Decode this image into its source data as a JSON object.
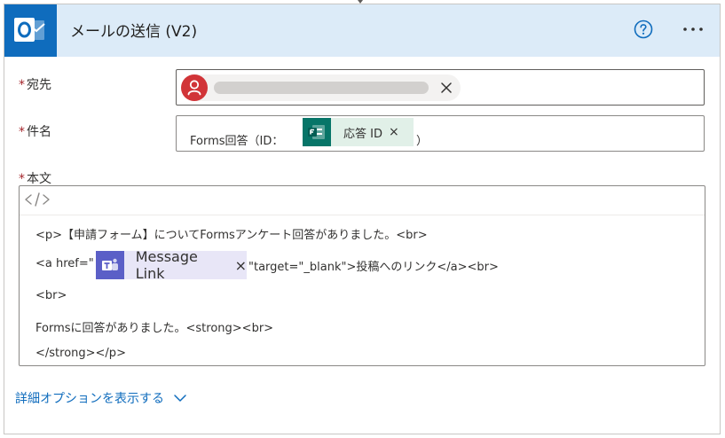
{
  "header": {
    "title": "メールの送信 (V2)",
    "app_icon": "outlook-icon",
    "help_icon": "help-circle-icon",
    "more_icon": "more-dots-icon",
    "background_color": "#dcebf8",
    "accent_color": "#0f6cbd"
  },
  "fields": {
    "to": {
      "required_mark": "*",
      "label": "宛先",
      "avatar_icon": "person-icon",
      "remove_icon": "close-icon"
    },
    "subject": {
      "required_mark": "*",
      "label": "件名",
      "text_before": "Forms回答（ID：",
      "token": {
        "label": "応答 ID",
        "remove": "×",
        "icon": "microsoft-forms-icon",
        "color": "#077568"
      },
      "text_after": "）"
    },
    "body": {
      "required_mark": "*",
      "label": "本文",
      "code_view_icon": "code-view-icon",
      "line1": "<p>【申請フォーム】についてFormsアンケート回答がありました。<br>",
      "line2_before": "<a href=\"",
      "line2_token": {
        "label": "Message Link",
        "remove": "×",
        "icon": "microsoft-teams-icon",
        "color": "#5b5fc7"
      },
      "line2_after": "\"target=\"_blank\">投稿へのリンク</a><br>",
      "line3": "<br>",
      "line4": "Formsに回答がありました。<strong><br>",
      "line5": "</strong></p>"
    }
  },
  "advanced_options": {
    "label": "詳細オプションを表示する",
    "icon": "chevron-down-icon"
  }
}
